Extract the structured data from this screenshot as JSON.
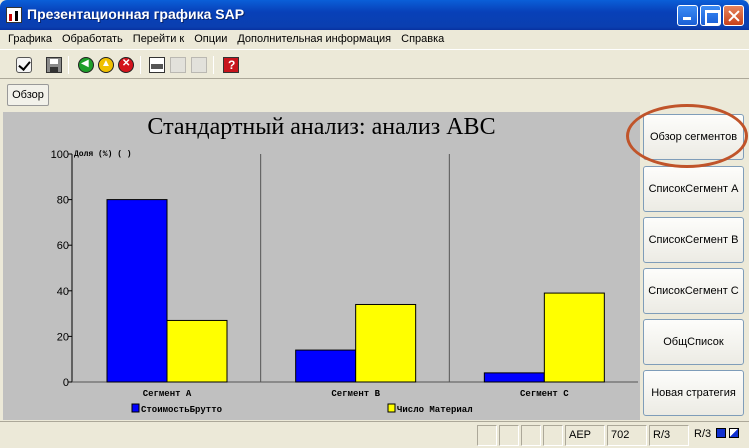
{
  "window": {
    "title": "Презентационная графика SAP"
  },
  "menu": [
    "Графика",
    "Обработать",
    "Перейти к",
    "Опции",
    "Дополнительная информация",
    "Справка"
  ],
  "toolbar": {
    "icons": [
      "check-icon",
      "save-icon",
      "back-icon",
      "exit-icon",
      "cancel-icon",
      "print-icon",
      "find-icon",
      "find-next-icon",
      "help-icon"
    ]
  },
  "overview_button": "Обзор",
  "side_buttons": [
    "Обзор сегментов",
    "СписокСегмент A",
    "СписокСегмент B",
    "СписокСегмент C",
    "ОбщСписок",
    "Новая стратегия"
  ],
  "status": {
    "cell1": "AEP",
    "cell2": "702",
    "cell3": "R/3",
    "cell4": "R/3"
  },
  "colors": {
    "series1": "#0000ff",
    "series2": "#ffff00",
    "chart_bg": "#c0c0c0",
    "highlight": "#c0542a"
  },
  "chart_data": {
    "type": "bar",
    "title": "Стандартный анализ: анализ ABC",
    "ylabel": "Доля (%) ( )",
    "categories": [
      "Сегмент A",
      "Сегмент B",
      "Сегмент C"
    ],
    "series": [
      {
        "name": "СтоимостьБрутто",
        "values": [
          80,
          14,
          4
        ]
      },
      {
        "name": "Число Материал",
        "values": [
          27,
          34,
          39
        ]
      }
    ],
    "ylim": [
      0,
      100
    ],
    "yticks": [
      0,
      20,
      40,
      60,
      80,
      100
    ],
    "grid": true,
    "legend": "bottom"
  }
}
